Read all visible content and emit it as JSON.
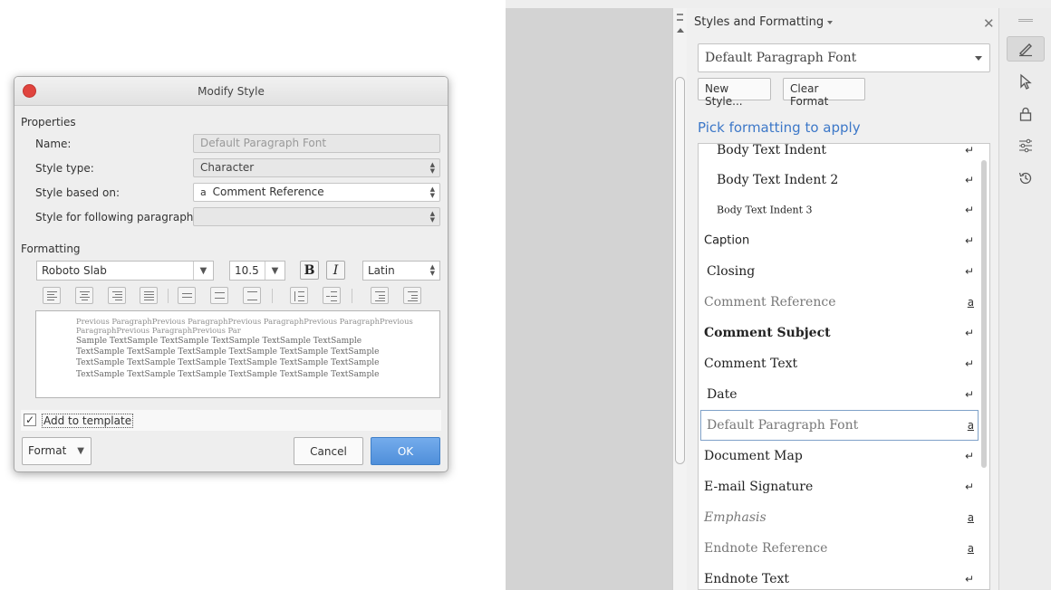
{
  "dialog": {
    "title": "Modify Style",
    "properties_heading": "Properties",
    "name_label": "Name:",
    "name_value": "Default Paragraph Font",
    "style_type_label": "Style type:",
    "style_type_value": "Character",
    "based_on_label": "Style based on:",
    "based_on_icon": "a",
    "based_on_value": "Comment Reference",
    "following_label": "Style for following paragraph:",
    "following_value": "",
    "formatting_heading": "Formatting",
    "font_name": "Roboto Slab",
    "font_size": "10.5",
    "bold_label": "B",
    "italic_label": "I",
    "script": "Latin",
    "preview": {
      "previous": "Previous ParagraphPrevious ParagraphPrevious ParagraphPrevious ParagraphPrevious ParagraphPrevious ParagraphPrevious Par",
      "sample_lines": [
        "Sample TextSample TextSample TextSample TextSample TextSample",
        "TextSample TextSample TextSample TextSample TextSample TextSample",
        "TextSample TextSample TextSample TextSample TextSample TextSample",
        "TextSample TextSample TextSample TextSample TextSample TextSample"
      ]
    },
    "add_to_template_label": "Add to template",
    "add_to_template_checked": true,
    "format_button": "Format",
    "cancel_button": "Cancel",
    "ok_button": "OK"
  },
  "sidebar": {
    "title": "Styles and Formatting",
    "close_glyph": "✕",
    "current_style": "Default Paragraph Font",
    "new_style_button": "New Style...",
    "clear_format_button": "Clear Format",
    "pick_heading": "Pick formatting to apply",
    "items": [
      {
        "label": "Body Text Indent",
        "mark": "↵",
        "style": "serif"
      },
      {
        "label": "Body Text Indent 2",
        "mark": "↵",
        "style": "serif"
      },
      {
        "label": "Body Text Indent 3",
        "mark": "↵",
        "style": "small"
      },
      {
        "label": "Caption",
        "mark": "↵",
        "style": "sans"
      },
      {
        "label": "Closing",
        "mark": "↵",
        "style": "serif"
      },
      {
        "label": "Comment Reference",
        "mark": "a",
        "style": "gray"
      },
      {
        "label": "Comment Subject",
        "mark": "↵",
        "style": "bold"
      },
      {
        "label": "Comment Text",
        "mark": "↵",
        "style": "serif"
      },
      {
        "label": "Date",
        "mark": "↵",
        "style": "serif"
      },
      {
        "label": "Default Paragraph Font",
        "mark": "a",
        "style": "gray"
      },
      {
        "label": "Document Map",
        "mark": "↵",
        "style": "serif"
      },
      {
        "label": "E-mail Signature",
        "mark": "↵",
        "style": "serif"
      },
      {
        "label": "Emphasis",
        "mark": "a",
        "style": "italic"
      },
      {
        "label": "Endnote Reference",
        "mark": "a",
        "style": "gray"
      },
      {
        "label": "Endnote Text",
        "mark": "↵",
        "style": "serif"
      }
    ],
    "selected_index": 9
  },
  "right_toolbar": {
    "icons": [
      "styles-icon",
      "pointer-icon",
      "lock-icon",
      "settings-sliders-icon",
      "history-icon"
    ],
    "active": "styles-icon"
  },
  "colors": {
    "accent_blue": "#3d78c8",
    "ok_button": "#5a98e0",
    "close_red": "#e0443e"
  }
}
